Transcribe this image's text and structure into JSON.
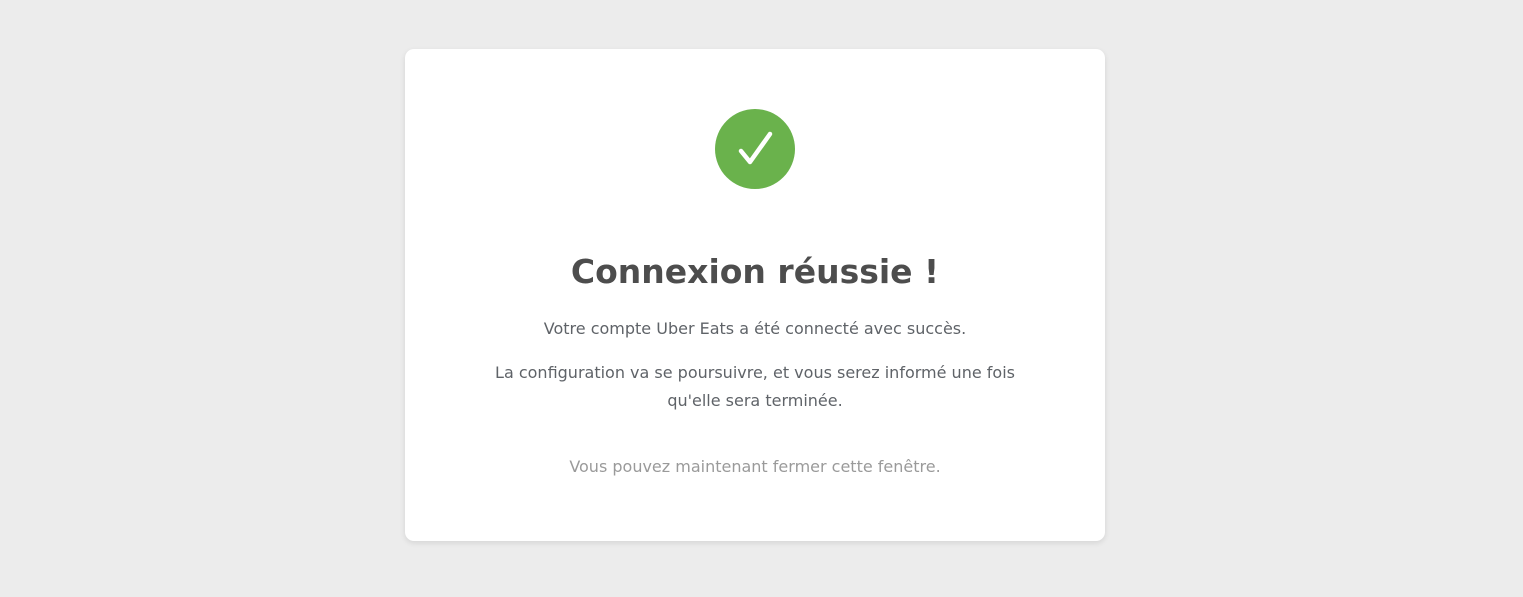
{
  "colors": {
    "page_background": "#ececec",
    "card_background": "#ffffff",
    "success_green": "#6ab24c",
    "title_text": "#4d4d4d",
    "body_text": "#5f6368",
    "muted_text": "#9a9a9a"
  },
  "status_icon": "check-icon",
  "title": "Connexion réussie !",
  "messages": [
    "Votre compte Uber Eats a été connecté avec succès.",
    "La configuration va se poursuivre, et vous serez informé une fois qu'elle sera terminée."
  ],
  "close_note": "Vous pouvez maintenant fermer cette fenêtre."
}
